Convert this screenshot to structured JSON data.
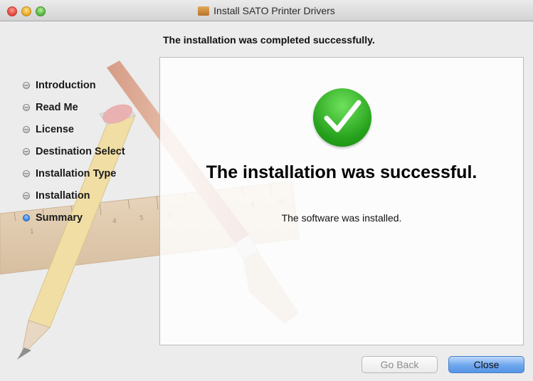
{
  "window": {
    "title": "Install SATO Printer Drivers",
    "subtitle": "The installation was completed successfully."
  },
  "steps": [
    {
      "label": "Introduction",
      "active": false
    },
    {
      "label": "Read Me",
      "active": false
    },
    {
      "label": "License",
      "active": false
    },
    {
      "label": "Destination Select",
      "active": false
    },
    {
      "label": "Installation Type",
      "active": false
    },
    {
      "label": "Installation",
      "active": false
    },
    {
      "label": "Summary",
      "active": true
    }
  ],
  "panel": {
    "headline": "The installation was successful.",
    "detail": "The software was installed."
  },
  "buttons": {
    "back": "Go Back",
    "close": "Close"
  },
  "colors": {
    "success_green": "#27a21c",
    "accent_blue": "#2f7fe2"
  },
  "icons": {
    "title": "package-icon",
    "success": "checkmark-icon",
    "background": "pencil-brush-ruler-illustration"
  }
}
